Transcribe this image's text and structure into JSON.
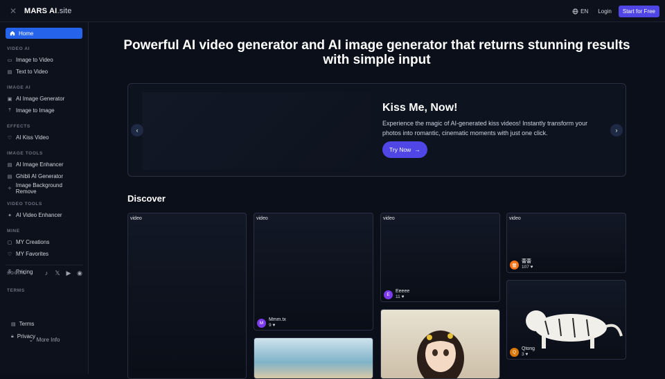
{
  "topbar": {
    "brand_main": "MARS AI",
    "brand_suffix": ".site",
    "lang": "EN",
    "login": "Login",
    "cta": "Start for Free"
  },
  "sidebar": {
    "home": "Home",
    "sections": [
      {
        "title": "VIDEO AI",
        "items": [
          {
            "label": "Image to Video",
            "icon": "video-icon"
          },
          {
            "label": "Text to Video",
            "icon": "document-icon"
          }
        ]
      },
      {
        "title": "IMAGE AI",
        "items": [
          {
            "label": "AI Image Generator",
            "icon": "image-icon"
          },
          {
            "label": "Image to Image",
            "icon": "upload-icon"
          }
        ]
      },
      {
        "title": "EFFECTS",
        "items": [
          {
            "label": "AI Kiss Video",
            "icon": "heart-icon"
          }
        ]
      },
      {
        "title": "IMAGE TOOLS",
        "items": [
          {
            "label": "AI Image Enhancer",
            "icon": "enhance-icon"
          },
          {
            "label": "Ghibli AI Generator",
            "icon": "document-icon"
          },
          {
            "label": "Image Background Remove",
            "icon": "magic-icon"
          }
        ]
      },
      {
        "title": "VIDEO TOOLS",
        "items": [
          {
            "label": "AI Video Enhancer",
            "icon": "sparkle-icon"
          }
        ]
      },
      {
        "title": "MINE",
        "items": [
          {
            "label": "MY Creations",
            "icon": "folder-icon"
          },
          {
            "label": "MY Favorites",
            "icon": "heart-icon"
          }
        ]
      }
    ],
    "pricing": "Pricing",
    "social_title": "SOCIAL",
    "terms_title": "TERMS",
    "terms": "Terms",
    "privacy": "Privacy",
    "more_info": "More Info"
  },
  "main": {
    "headline": "Powerful AI video generator and AI image generator that returns stunning results with simple input",
    "hero": {
      "title": "Kiss Me, Now!",
      "description": "Experience the magic of AI-generated kiss videos! Instantly transform your photos into romantic, cinematic moments with just one click.",
      "button": "Try Now"
    },
    "discover": "Discover",
    "cards": [
      {
        "tag": "video",
        "author": "",
        "initial": "",
        "likes": ""
      },
      {
        "tag": "video",
        "author": "Mmm.tx",
        "initial": "M",
        "likes": "9",
        "avatar_color": "#7c3aed"
      },
      {
        "tag": "video",
        "author": "Eeeee",
        "initial": "E",
        "likes": "11",
        "avatar_color": "#7c3aed"
      },
      {
        "tag": "video",
        "author": "蕾蕾",
        "initial": "蕾",
        "likes": "107",
        "avatar_color": "#f97316"
      },
      {
        "tag": "",
        "author": "Qtong",
        "initial": "Q",
        "likes": "3",
        "avatar_color": "#d97706"
      }
    ]
  },
  "colors": {
    "accent": "#4f46e5",
    "home_active": "#2563eb",
    "background": "#0b0f19"
  }
}
